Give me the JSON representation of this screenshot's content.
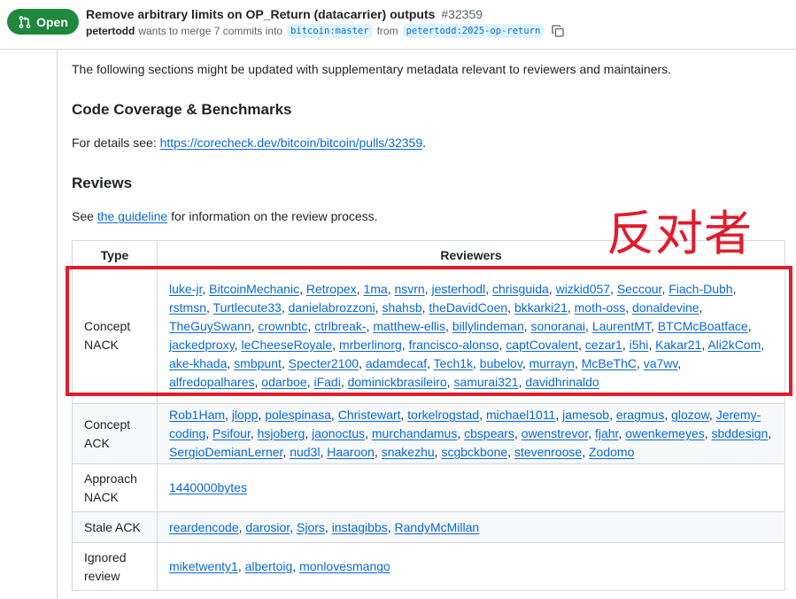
{
  "header": {
    "state": "Open",
    "title": "Remove arbitrary limits on OP_Return (datacarrier) outputs",
    "number": "#32359",
    "author": "petertodd",
    "merge_text": "wants to merge 7 commits into",
    "base_branch": "bitcoin:master",
    "from_text": "from",
    "head_branch": "petertodd:2025-op-return",
    "colors": {
      "open": "#1f883d",
      "link": "#0969da",
      "branch_bg": "#ddf4ff"
    }
  },
  "body": {
    "intro": "The following sections might be updated with supplementary metadata relevant to reviewers and maintainers.",
    "coverage_heading": "Code Coverage & Benchmarks",
    "details_prefix": "For details see: ",
    "details_link": "https://corecheck.dev/bitcoin/bitcoin/pulls/32359",
    "details_suffix": ".",
    "reviews_heading": "Reviews",
    "see_prefix": "See ",
    "see_link": "the guideline",
    "see_suffix": " for information on the review process."
  },
  "table": {
    "headers": [
      "Type",
      "Reviewers"
    ],
    "rows": [
      {
        "type": "Concept NACK",
        "reviewers": [
          "luke-jr",
          "BitcoinMechanic",
          "Retropex",
          "1ma",
          "nsvrn",
          "jesterhodl",
          "chrisguida",
          "wizkid057",
          "Seccour",
          "Fiach-Dubh",
          "rstmsn",
          "Turtlecute33",
          "danielabrozzoni",
          "shahsb",
          "theDavidCoen",
          "bkkarki21",
          "moth-oss",
          "donaldevine",
          "TheGuySwann",
          "crownbtc",
          "ctrlbreak-",
          "matthew-ellis",
          "billylindeman",
          "sonoranai",
          "LaurentMT",
          "BTCMcBoatface",
          "jackedproxy",
          "leCheeseRoyale",
          "mrberlinorg",
          "francisco-alonso",
          "captCovalent",
          "cezar1",
          "i5hi",
          "Kakar21",
          "Ali2kCom",
          "ake-khada",
          "smbpunt",
          "Specter2100",
          "adamdecaf",
          "Tech1k",
          "bubelov",
          "murrayn",
          "McBeThC",
          "va7wv",
          "alfredopalhares",
          "odarboe",
          "iFadi",
          "dominickbrasileiro",
          "samurai321",
          "davidhrinaldo"
        ]
      },
      {
        "type": "Concept ACK",
        "reviewers": [
          "Rob1Ham",
          "jlopp",
          "polespinasa",
          "Christewart",
          "torkelrogstad",
          "michael1011",
          "jamesob",
          "eragmus",
          "glozow",
          "Jeremy-coding",
          "Psifour",
          "hsjoberg",
          "jaonoctus",
          "murchandamus",
          "cbspears",
          "owenstrevor",
          "fjahr",
          "owenkemeyes",
          "sbddesign",
          "SergioDemianLerner",
          "nud3l",
          "Haaroon",
          "snakezhu",
          "scgbckbone",
          "stevenroose",
          "Zodomo"
        ]
      },
      {
        "type": "Approach NACK",
        "reviewers": [
          "1440000bytes"
        ]
      },
      {
        "type": "Stale ACK",
        "reviewers": [
          "reardencode",
          "darosior",
          "Sjors",
          "instagibbs",
          "RandyMcMillan"
        ]
      },
      {
        "type": "Ignored review",
        "reviewers": [
          "miketwenty1",
          "albertoig",
          "monlovesmango"
        ]
      }
    ]
  },
  "annotation": {
    "text": "反对者",
    "color": "#e11c2b"
  }
}
